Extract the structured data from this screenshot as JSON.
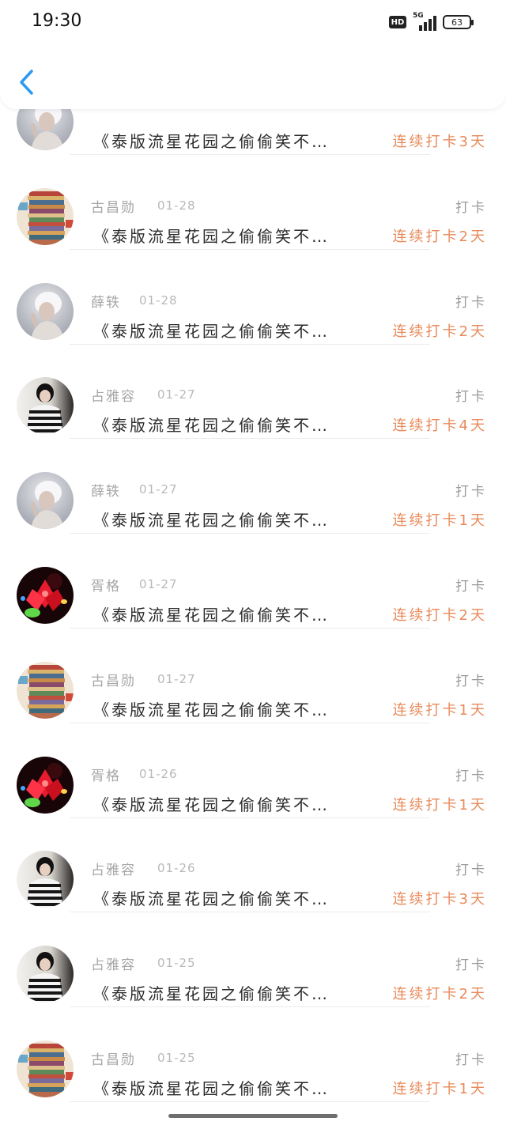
{
  "status_bar": {
    "time": "19:30",
    "network_badge": "HD",
    "network_type": "5G",
    "battery": "63"
  },
  "header": {
    "back_icon": "chevron-left-icon"
  },
  "colors": {
    "accent": "#2b9af3",
    "streak": "#e88a5a",
    "meta": "#a6a6a6"
  },
  "records": [
    {
      "name": "",
      "date": "",
      "type": "",
      "title": "《泰版流星花园之偷偷笑不…",
      "streak": "连续打卡3天",
      "avatar": "white-hair-portrait"
    },
    {
      "name": "古昌勋",
      "date": "01-28",
      "type": "打卡",
      "title": "《泰版流星花园之偷偷笑不…",
      "streak": "连续打卡2天",
      "avatar": "fabric-stack"
    },
    {
      "name": "薛轶",
      "date": "01-28",
      "type": "打卡",
      "title": "《泰版流星花园之偷偷笑不…",
      "streak": "连续打卡2天",
      "avatar": "white-hair-portrait"
    },
    {
      "name": "占雅容",
      "date": "01-27",
      "type": "打卡",
      "title": "《泰版流星花园之偷偷笑不…",
      "streak": "连续打卡4天",
      "avatar": "striped-shirt-person"
    },
    {
      "name": "薛轶",
      "date": "01-27",
      "type": "打卡",
      "title": "《泰版流星花园之偷偷笑不…",
      "streak": "连续打卡1天",
      "avatar": "white-hair-portrait"
    },
    {
      "name": "胥格",
      "date": "01-27",
      "type": "打卡",
      "title": "《泰版流星花园之偷偷笑不…",
      "streak": "连续打卡2天",
      "avatar": "red-lotus-light"
    },
    {
      "name": "古昌勋",
      "date": "01-27",
      "type": "打卡",
      "title": "《泰版流星花园之偷偷笑不…",
      "streak": "连续打卡1天",
      "avatar": "fabric-stack"
    },
    {
      "name": "胥格",
      "date": "01-26",
      "type": "打卡",
      "title": "《泰版流星花园之偷偷笑不…",
      "streak": "连续打卡1天",
      "avatar": "red-lotus-light"
    },
    {
      "name": "占雅容",
      "date": "01-26",
      "type": "打卡",
      "title": "《泰版流星花园之偷偷笑不…",
      "streak": "连续打卡3天",
      "avatar": "striped-shirt-person"
    },
    {
      "name": "占雅容",
      "date": "01-25",
      "type": "打卡",
      "title": "《泰版流星花园之偷偷笑不…",
      "streak": "连续打卡2天",
      "avatar": "striped-shirt-person"
    },
    {
      "name": "古昌勋",
      "date": "01-25",
      "type": "打卡",
      "title": "《泰版流星花园之偷偷笑不…",
      "streak": "连续打卡1天",
      "avatar": "fabric-stack"
    }
  ]
}
